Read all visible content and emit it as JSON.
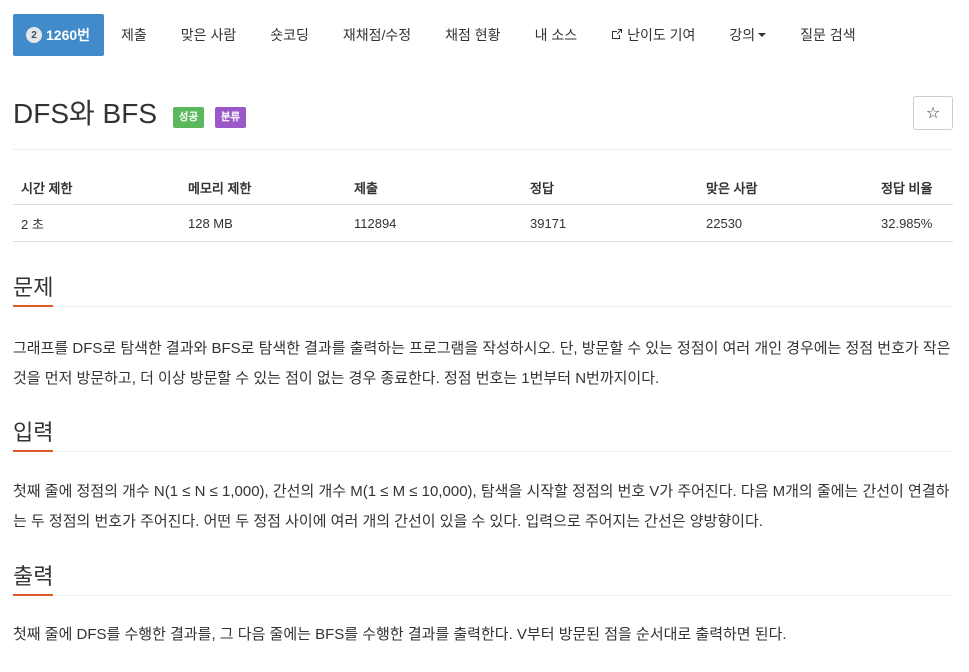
{
  "nav": {
    "problem_number": "1260번",
    "items": [
      "제출",
      "맞은 사람",
      "숏코딩",
      "재채점/수정",
      "채점 현황",
      "내 소스",
      "난이도 기여",
      "강의",
      "질문 검색"
    ]
  },
  "title": {
    "text": "DFS와 BFS",
    "labels": [
      "성공",
      "분류"
    ],
    "star": "☆"
  },
  "info_table": {
    "headers": [
      "시간 제한",
      "메모리 제한",
      "제출",
      "정답",
      "맞은 사람",
      "정답 비율"
    ],
    "row": [
      "2 초",
      "128 MB",
      "112894",
      "39171",
      "22530",
      "32.985%"
    ]
  },
  "sections": {
    "problem": {
      "heading": "문제",
      "text": "그래프를 DFS로 탐색한 결과와 BFS로 탐색한 결과를 출력하는 프로그램을 작성하시오. 단, 방문할 수 있는 정점이 여러 개인 경우에는 정점 번호가 작은 것을 먼저 방문하고, 더 이상 방문할 수 있는 점이 없는 경우 종료한다. 정점 번호는 1번부터 N번까지이다."
    },
    "input": {
      "heading": "입력",
      "text": "첫째 줄에 정점의 개수 N(1 ≤ N ≤ 1,000), 간선의 개수 M(1 ≤ M ≤ 10,000), 탐색을 시작할 정점의 번호 V가 주어진다. 다음 M개의 줄에는 간선이 연결하는 두 정점의 번호가 주어진다. 어떤 두 정점 사이에 여러 개의 간선이 있을 수 있다. 입력으로 주어지는 간선은 양방향이다."
    },
    "output": {
      "heading": "출력",
      "text": "첫째 줄에 DFS를 수행한 결과를, 그 다음 줄에는 BFS를 수행한 결과를 출력한다. V부터 방문된 점을 순서대로 출력하면 된다."
    }
  }
}
